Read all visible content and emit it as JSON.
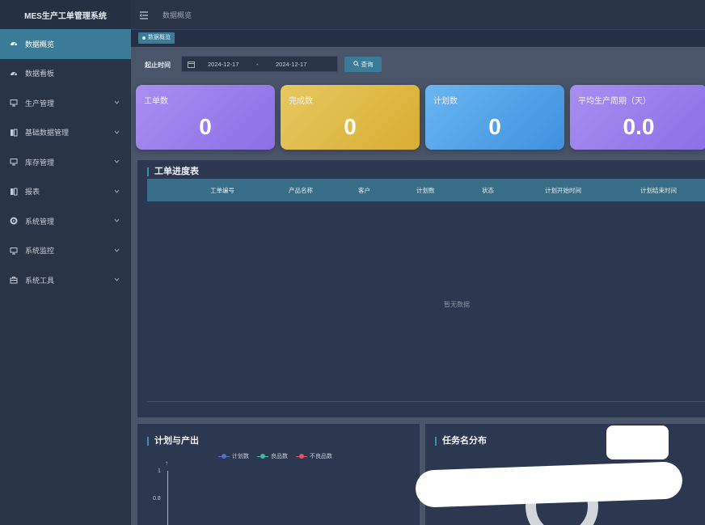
{
  "app": {
    "title": "MES生产工单管理系统"
  },
  "sidebar": {
    "items": [
      {
        "label": "数据概览",
        "icon": "dashboard-icon",
        "active": true,
        "expandable": false
      },
      {
        "label": "数据看板",
        "icon": "dashboard-icon",
        "active": false,
        "expandable": false
      },
      {
        "label": "生产管理",
        "icon": "monitor-icon",
        "active": false,
        "expandable": true
      },
      {
        "label": "基础数据管理",
        "icon": "book-icon",
        "active": false,
        "expandable": true
      },
      {
        "label": "库存管理",
        "icon": "monitor-icon",
        "active": false,
        "expandable": true
      },
      {
        "label": "报表",
        "icon": "book-icon",
        "active": false,
        "expandable": true
      },
      {
        "label": "系统管理",
        "icon": "gear-icon",
        "active": false,
        "expandable": true
      },
      {
        "label": "系统监控",
        "icon": "monitor-icon",
        "active": false,
        "expandable": true
      },
      {
        "label": "系统工具",
        "icon": "toolbox-icon",
        "active": false,
        "expandable": true
      }
    ]
  },
  "topbar": {
    "breadcrumb": "数据概览"
  },
  "tags": {
    "active": "数据概览"
  },
  "filter": {
    "label": "起止时间",
    "start_date": "2024-12-17",
    "separator": "-",
    "end_date": "2024-12-17",
    "query_label": "查询"
  },
  "stats": [
    {
      "title": "工单数",
      "value": "0"
    },
    {
      "title": "完成数",
      "value": "0"
    },
    {
      "title": "计划数",
      "value": "0"
    },
    {
      "title": "平均生产周期（天）",
      "value": "0.0"
    }
  ],
  "progress_table": {
    "title": "工单进度表",
    "columns": [
      "工单编号",
      "产品名称",
      "客户",
      "计划数",
      "状态",
      "计划开始时间",
      "计划结束时间"
    ],
    "empty_text": "暂无数据"
  },
  "plan_chart": {
    "title": "计划与产出",
    "legend": [
      {
        "name": "计划数",
        "color": "#5470c6"
      },
      {
        "name": "良品数",
        "color": "#3fb8a0"
      },
      {
        "name": "不良品数",
        "color": "#e05568"
      }
    ],
    "y_ticks": [
      "1",
      "0.8"
    ]
  },
  "task_chart": {
    "title": "任务名分布"
  },
  "chart_data": {
    "type": "line",
    "title": "计划与产出",
    "series": [
      {
        "name": "计划数",
        "values": []
      },
      {
        "name": "良品数",
        "values": []
      },
      {
        "name": "不良品数",
        "values": []
      }
    ],
    "yticks": [
      "1",
      "0.8"
    ],
    "legend_position": "top"
  }
}
